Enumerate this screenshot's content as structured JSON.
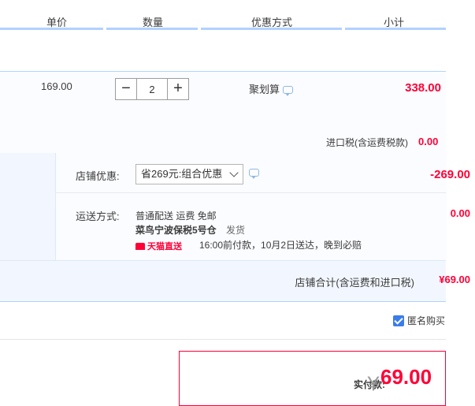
{
  "header": {
    "col_price": "单价",
    "col_qty": "数量",
    "col_promo": "优惠方式",
    "col_subtotal": "小计"
  },
  "item": {
    "price": "169.00",
    "quantity": "2",
    "promo": "聚划算",
    "subtotal": "338.00",
    "tax_label": "进口税(含运费税款)",
    "tax_value": "0.00"
  },
  "shop_promo": {
    "label": "店铺优惠:",
    "selected": "省269元:组合优惠",
    "discount": "-269.00"
  },
  "shipping": {
    "label": "运送方式:",
    "method": "普通配送 运费 免邮",
    "warehouse": "菜鸟宁波保税5号仓",
    "warehouse_suffix": "发货",
    "badge": "天猫直送",
    "note": "16:00前付款，10月2日送达，晚到必赔",
    "value": "0.00"
  },
  "shop_total": {
    "label": "店铺合计(含运费和进口税)",
    "value": "¥69.00"
  },
  "anonymous": {
    "label": "匿名购买",
    "checked": true
  },
  "payment": {
    "label": "实付款:",
    "currency": "￥",
    "amount": "69.00"
  },
  "colors": {
    "accent_red": "#ff0036",
    "border_blue": "#b2d1ff",
    "checkbox_blue": "#3b7de8"
  }
}
